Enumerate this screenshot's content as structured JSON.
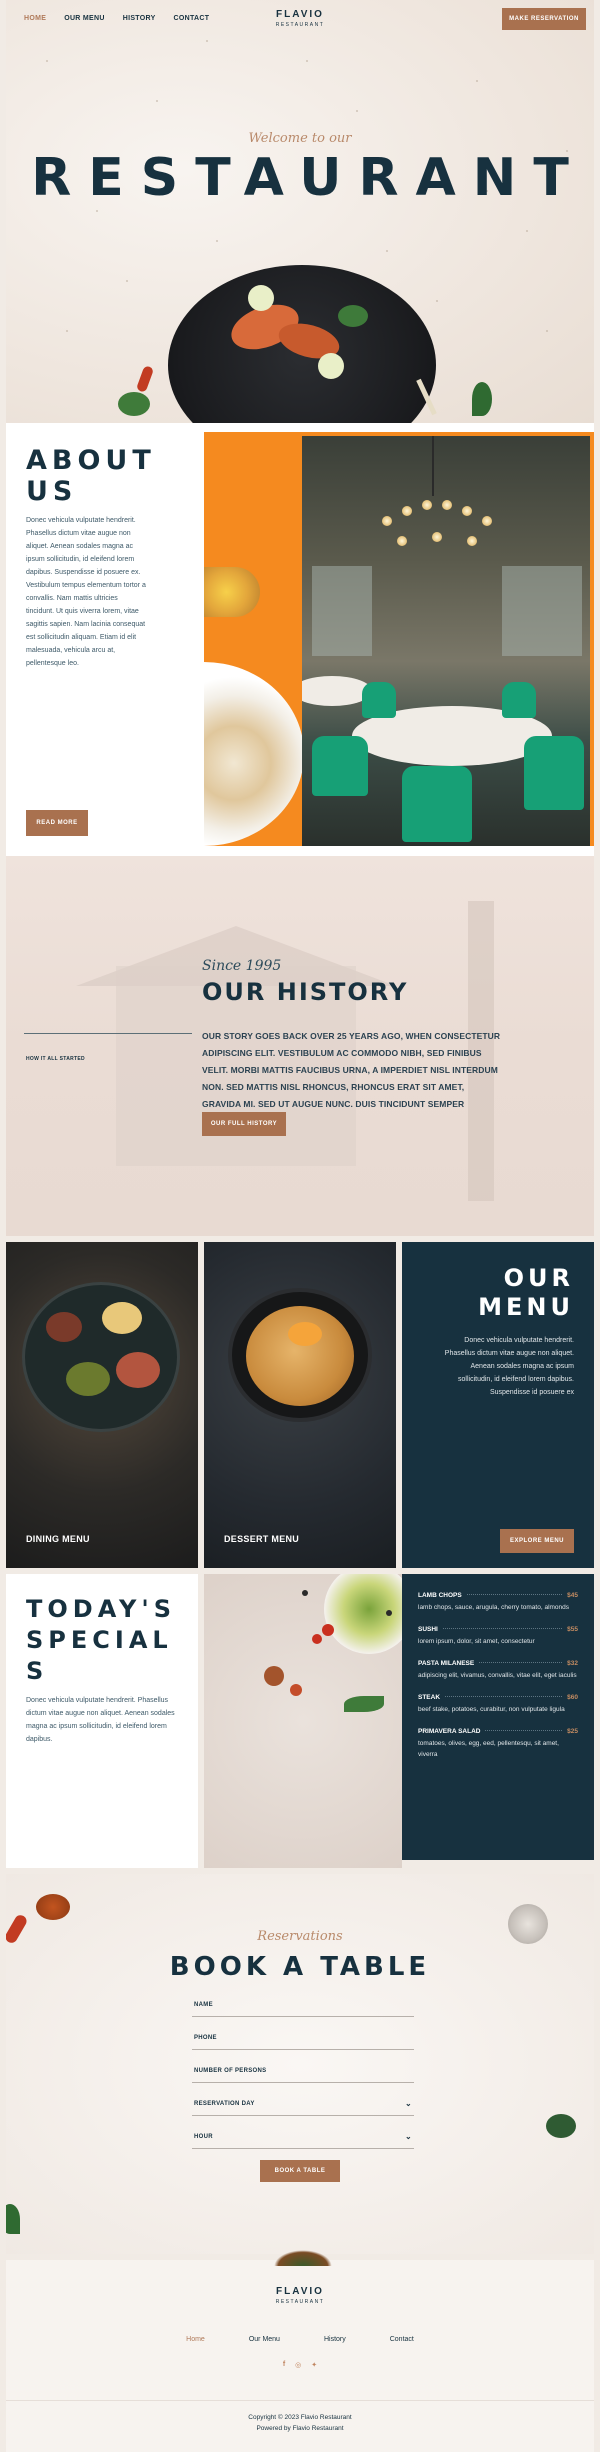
{
  "nav": {
    "links": [
      "HOME",
      "OUR MENU",
      "HISTORY",
      "CONTACT"
    ],
    "active": "HOME",
    "logo_main": "FLAVIO",
    "logo_sub": "RESTAURANT",
    "cta": "MAKE RESERVATION"
  },
  "hero": {
    "welcome": "Welcome to our",
    "title": "RESTAURANT"
  },
  "about": {
    "title_line1": "ABOUT",
    "title_line2": "US",
    "text": "Donec vehicula vulputate hendrerit. Phasellus dictum vitae augue non aliquet. Aenean sodales magna ac ipsum sollicitudin, id eleifend lorem dapibus. Suspendisse id posuere ex. Vestibulum tempus elementum tortor a convallis. Nam mattis ultricies tincidunt. Ut quis viverra lorem, vitae sagittis sapien. Nam lacinia consequat est sollicitudin aliquam. Etiam id elit malesuada, vehicula arcu at, pellentesque leo.",
    "button": "READ MORE"
  },
  "history": {
    "since": "Since 1995",
    "title": "OUR HISTORY",
    "scroll_label": "HOW IT ALL STARTED",
    "story": "OUR STORY GOES BACK OVER 25 YEARS AGO, WHEN CONSECTETUR ADIPISCING ELIT. VESTIBULUM AC COMMODO NIBH, SED FINIBUS VELIT. MORBI MATTIS FAUCIBUS URNA, A IMPERDIET NISL INTERDUM NON. SED MATTIS NISL RHONCUS, RHONCUS ERAT SIT AMET, GRAVIDA MI. SED UT AUGUE NUNC. DUIS TINCIDUNT SEMPER SAGITTIS...",
    "button": "OUR FULL HISTORY"
  },
  "menu": {
    "dining_label": "DINING MENU",
    "dessert_label": "DESSERT MENU",
    "title_line1": "OUR",
    "title_line2": "MENU",
    "text": "Donec vehicula vulputate hendrerit. Phasellus dictum vitae augue non aliquet. Aenean sodales magna ac ipsum sollicitudin, id eleifend lorem dapibus. Suspendisse id posuere ex",
    "button": "EXPLORE MENU"
  },
  "specials": {
    "title_line1": "TODAY'S",
    "title_line2": "SPECIAL",
    "title_line3": "S",
    "text": "Donec vehicula vulputate hendrerit. Phasellus dictum vitae augue non aliquet. Aenean sodales magna ac ipsum sollicitudin, id eleifend lorem dapibus.",
    "items": [
      {
        "name": "LAMB CHOPS",
        "price": "$45",
        "desc": "lamb chops, sauce, arugula, cherry tomato, almonds"
      },
      {
        "name": "SUSHI",
        "price": "$55",
        "desc": "lorem ipsum, dolor, sit amet, consectetur"
      },
      {
        "name": "PASTA MILANESE",
        "price": "$32",
        "desc": "adipiscing elit, vivamus, convallis, vitae elit, eget iaculis"
      },
      {
        "name": "STEAK",
        "price": "$60",
        "desc": "beef stake, potatoes, curabitur, non vulputate ligula"
      },
      {
        "name": "PRIMAVERA SALAD",
        "price": "$25",
        "desc": "tomatoes, olives, egg, eed, pellentesqu, sit amet, viverra"
      }
    ]
  },
  "booking": {
    "eyebrow": "Reservations",
    "title": "BOOK A TABLE",
    "fields": [
      "NAME",
      "PHONE",
      "NUMBER OF PERSONS",
      "RESERVATION DAY",
      "HOUR"
    ],
    "button": "BOOK A TABLE"
  },
  "footer": {
    "logo_main": "FLAVIO",
    "logo_sub": "RESTAURANT",
    "links": [
      "Home",
      "Our Menu",
      "History",
      "Contact"
    ],
    "active": "Home",
    "social": [
      "facebook-icon",
      "instagram-icon",
      "twitter-icon"
    ],
    "copyright": "Copyright © 2023 Flavio Restaurant",
    "powered": "Powered by Flavio Restaurant"
  },
  "colors": {
    "navy": "#17313f",
    "accent": "#a9714f",
    "orange": "#f58a1f",
    "green_chairs": "#17a076"
  }
}
